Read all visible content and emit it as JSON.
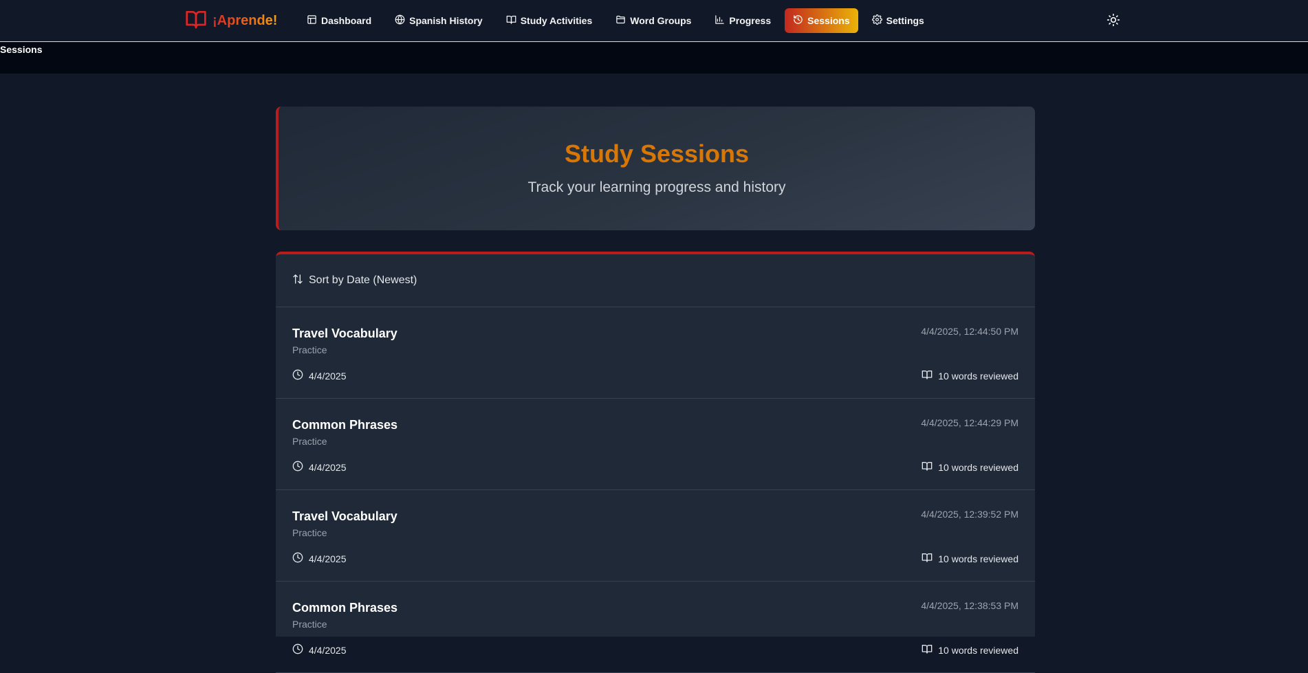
{
  "brand": {
    "name": "¡Aprende!",
    "icon": "book-open-icon"
  },
  "nav": {
    "items": [
      {
        "label": "Dashboard",
        "icon": "layout-icon",
        "active": false
      },
      {
        "label": "Spanish History",
        "icon": "globe-icon",
        "active": false
      },
      {
        "label": "Study Activities",
        "icon": "book-open-icon",
        "active": false
      },
      {
        "label": "Word Groups",
        "icon": "folder-icon",
        "active": false
      },
      {
        "label": "Progress",
        "icon": "bar-chart-icon",
        "active": false
      },
      {
        "label": "Sessions",
        "icon": "history-icon",
        "active": true
      },
      {
        "label": "Settings",
        "icon": "gear-icon",
        "active": false
      }
    ],
    "theme_toggle_icon": "sun-icon"
  },
  "breadcrumb": "Sessions",
  "hero": {
    "title": "Study Sessions",
    "subtitle": "Track your learning progress and history"
  },
  "sort": {
    "label": "Sort by Date (Newest)",
    "icon": "arrows-up-down-icon"
  },
  "sessions": [
    {
      "title": "Travel Vocabulary",
      "type": "Practice",
      "timestamp": "4/4/2025, 12:44:50 PM",
      "date": "4/4/2025",
      "words": "10 words reviewed"
    },
    {
      "title": "Common Phrases",
      "type": "Practice",
      "timestamp": "4/4/2025, 12:44:29 PM",
      "date": "4/4/2025",
      "words": "10 words reviewed"
    },
    {
      "title": "Travel Vocabulary",
      "type": "Practice",
      "timestamp": "4/4/2025, 12:39:52 PM",
      "date": "4/4/2025",
      "words": "10 words reviewed"
    },
    {
      "title": "Common Phrases",
      "type": "Practice",
      "timestamp": "4/4/2025, 12:38:53 PM",
      "date": "4/4/2025",
      "words": "10 words reviewed"
    }
  ],
  "colors": {
    "accent_red": "#b91c1c",
    "accent_orange": "#d97706",
    "accent_gold": "#eab308",
    "background": "#111827",
    "card": "#1f2937"
  }
}
